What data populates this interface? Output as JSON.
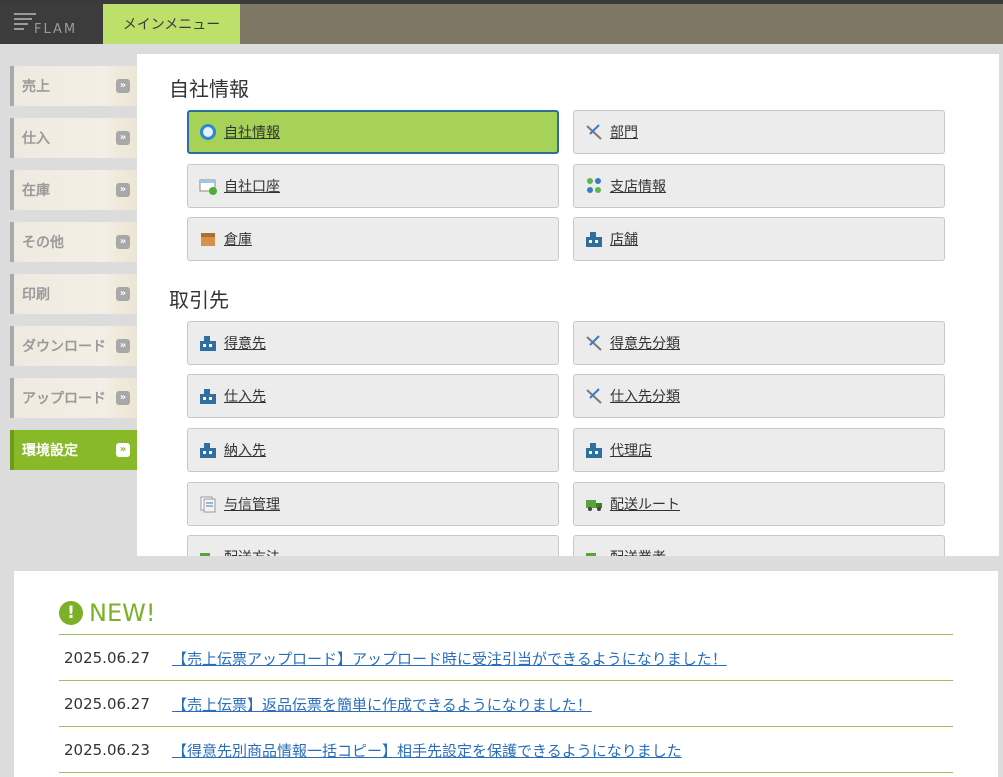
{
  "header": {
    "logo_text": "FLAM",
    "active_tab": "メインメニュー"
  },
  "sidebar": {
    "items": [
      {
        "label": "売上"
      },
      {
        "label": "仕入"
      },
      {
        "label": "在庫"
      },
      {
        "label": "その他"
      },
      {
        "label": "印刷"
      },
      {
        "label": "ダウンロード"
      },
      {
        "label": "アップロード"
      },
      {
        "label": "環境設定"
      }
    ],
    "chevron": "»"
  },
  "main": {
    "sections": [
      {
        "title": "自社情報"
      },
      {
        "title": "取引先"
      }
    ],
    "buttons": [
      {
        "label": "自社情報",
        "icon": "globe-icon"
      },
      {
        "label": "部門",
        "icon": "tools-icon"
      },
      {
        "label": "自社口座",
        "icon": "account-card-icon"
      },
      {
        "label": "支店情報",
        "icon": "branch-icon"
      },
      {
        "label": "倉庫",
        "icon": "box-icon"
      },
      {
        "label": "店舗",
        "icon": "building-icon"
      },
      {
        "label": "得意先",
        "icon": "building-icon"
      },
      {
        "label": "得意先分類",
        "icon": "tools-icon"
      },
      {
        "label": "仕入先",
        "icon": "building-icon"
      },
      {
        "label": "仕入先分類",
        "icon": "tools-icon"
      },
      {
        "label": "納入先",
        "icon": "building-icon"
      },
      {
        "label": "代理店",
        "icon": "building-icon"
      },
      {
        "label": "与信管理",
        "icon": "documents-icon"
      },
      {
        "label": "配送ルート",
        "icon": "truck-icon"
      },
      {
        "label": "配送方法",
        "icon": "truck-icon"
      },
      {
        "label": "配送業者",
        "icon": "truck-icon"
      }
    ]
  },
  "news": {
    "title": "NEW!",
    "mark": "!",
    "items": [
      {
        "date": "2025.06.27",
        "text": "【売上伝票アップロード】アップロード時に受注引当ができるようになりました！"
      },
      {
        "date": "2025.06.27",
        "text": "【売上伝票】返品伝票を簡単に作成できるようになりました！"
      },
      {
        "date": "2025.06.23",
        "text": "【得意先別商品情報一括コピー】相手先設定を保護できるようになりました"
      }
    ]
  },
  "colors": {
    "accent": "#88b928",
    "tab": "#bde06b",
    "topbar": "#7f7765",
    "link": "#2a6ebb"
  }
}
